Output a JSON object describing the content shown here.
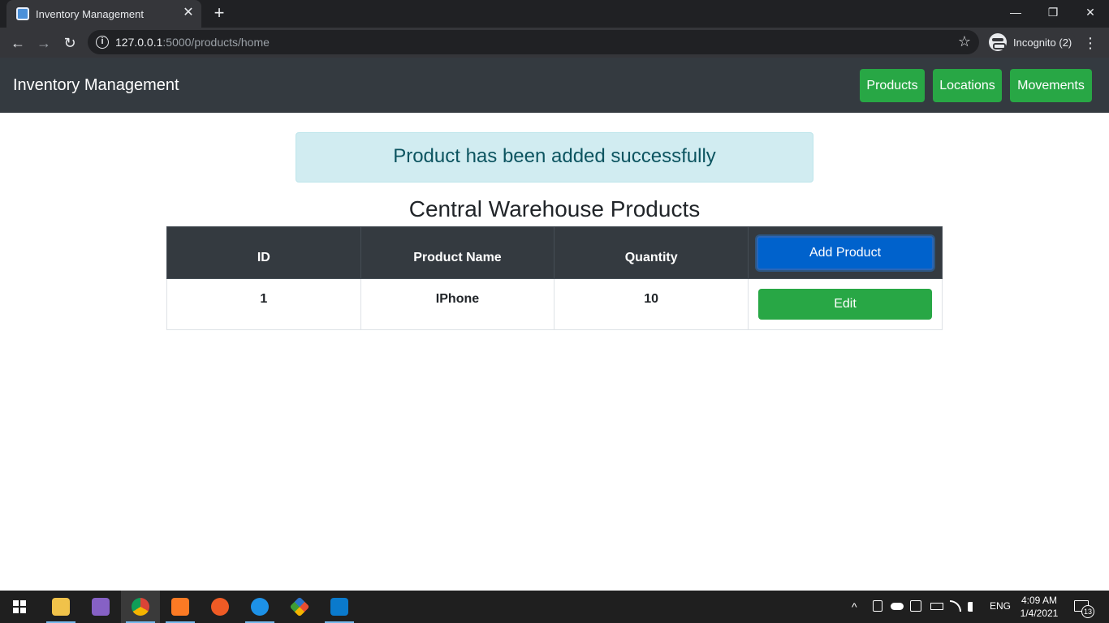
{
  "browser": {
    "tab_title": "Inventory Management",
    "tab_close": "✕",
    "new_tab": "+",
    "url_host": "127.0.0.1",
    "url_rest": ":5000/products/home",
    "profile_label": "Incognito (2)",
    "window_controls": {
      "minimize": "—",
      "restore": "❐",
      "close": "✕"
    },
    "nav": {
      "back": "←",
      "forward": "→",
      "reload": "↻",
      "star": "☆",
      "menu": "⋮",
      "info": "i"
    }
  },
  "navbar": {
    "brand": "Inventory Management",
    "buttons": [
      "Products",
      "Locations",
      "Movements"
    ],
    "button_color": "#28a745",
    "background": "#343a40"
  },
  "alert": {
    "message": "Product has been added successfully",
    "background": "#d1ecf1",
    "text_color": "#0c5460"
  },
  "page_title": "Central Warehouse Products",
  "table": {
    "headers": [
      "ID",
      "Product Name",
      "Quantity"
    ],
    "add_button": "Add Product",
    "rows": [
      {
        "id": "1",
        "name": "IPhone",
        "quantity": "10",
        "action": "Edit"
      }
    ]
  },
  "taskbar": {
    "apps": [
      "file-explorer",
      "visual-studio",
      "chrome",
      "xampp",
      "postman",
      "docker",
      "git",
      "vs-code"
    ],
    "tray": {
      "chevron": "^",
      "language": "ENG",
      "time": "4:09 AM",
      "date": "1/4/2021",
      "notification_count": "13"
    }
  }
}
